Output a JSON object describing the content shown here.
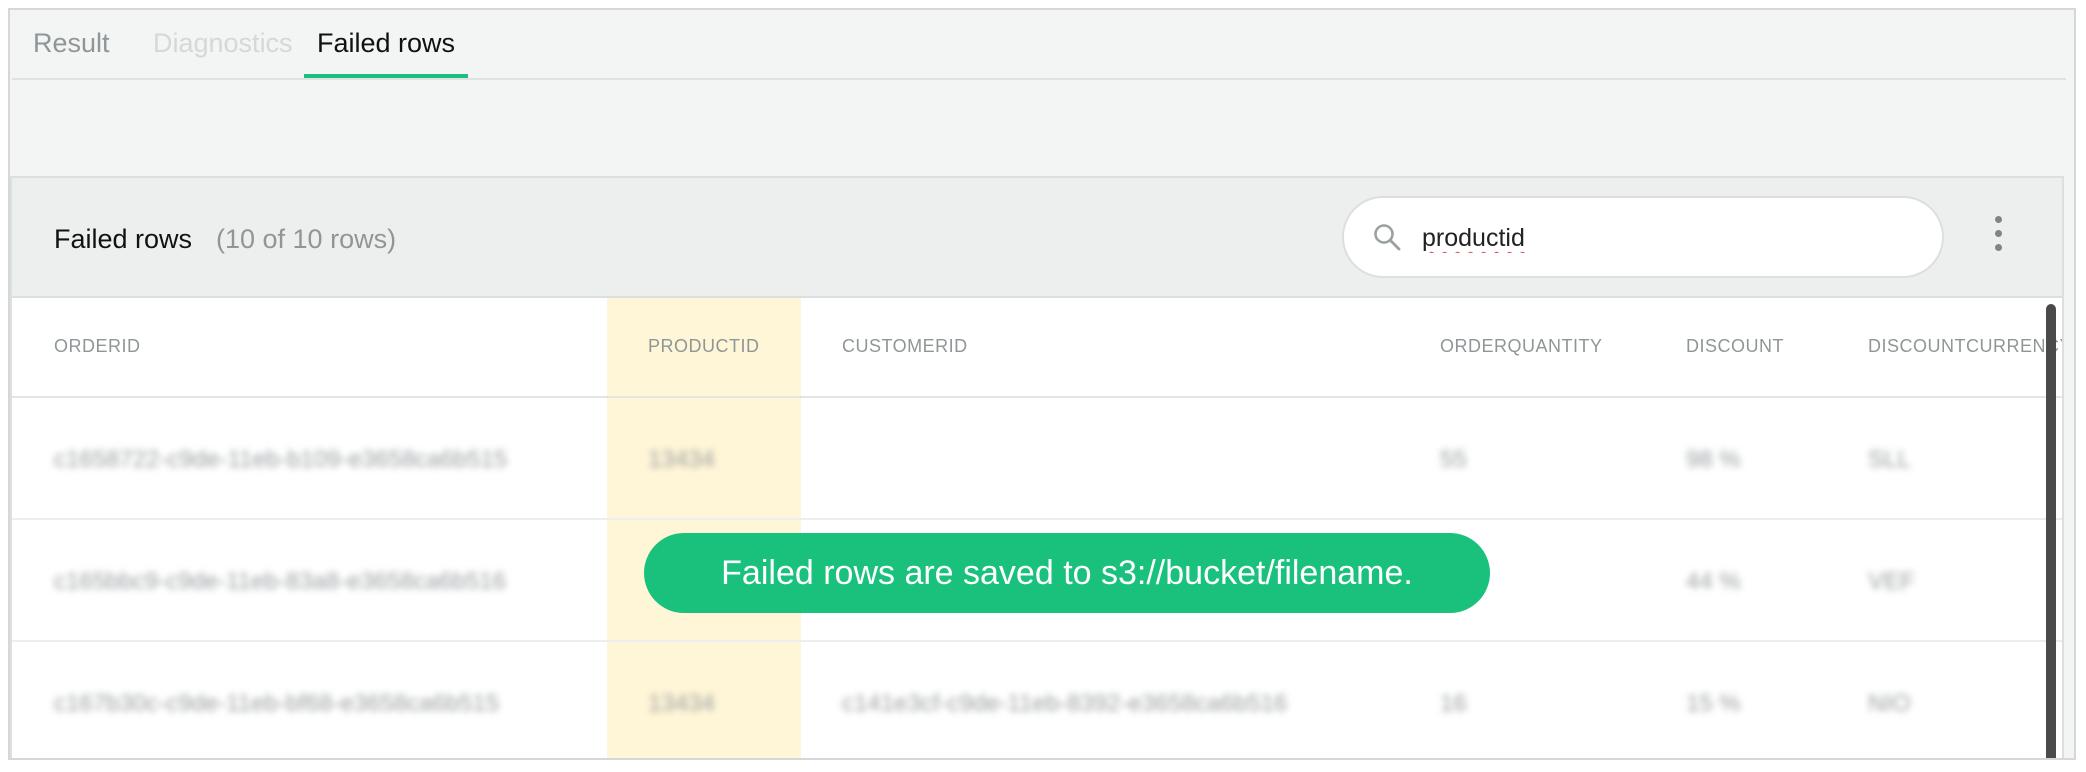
{
  "tabs": [
    {
      "label": "Result",
      "state": "inactive"
    },
    {
      "label": "Diagnostics",
      "state": "disabled"
    },
    {
      "label": "Failed rows",
      "state": "active"
    }
  ],
  "panel": {
    "title": "Failed rows",
    "count": "(10 of 10 rows)",
    "search": {
      "value": "productid"
    }
  },
  "table": {
    "columns": [
      "ORDERID",
      "PRODUCTID",
      "CUSTOMERID",
      "ORDERQUANTITY",
      "DISCOUNT",
      "DISCOUNTCURRENCY"
    ],
    "highlighted_column": "PRODUCTID",
    "rows": [
      [
        "c1658722-c9de-11eb-b109-e3658ca6b515",
        "13434",
        "",
        "55",
        "98 %",
        "SLL"
      ],
      [
        "c165bbc9-c9de-11eb-83a8-e3658ca6b516",
        "",
        "",
        "",
        "44 %",
        "VEF"
      ],
      [
        "c167b30c-c9de-11eb-bf68-e3658ca6b515",
        "13434",
        "c141e3cf-c9de-11eb-8392-e3658ca6b516",
        "16",
        "15 %",
        "NIO"
      ]
    ]
  },
  "toast": {
    "message": "Failed rows are saved to s3://bucket/filename."
  },
  "colors": {
    "accent": "#19c17d",
    "highlight": "#fff6d8"
  }
}
